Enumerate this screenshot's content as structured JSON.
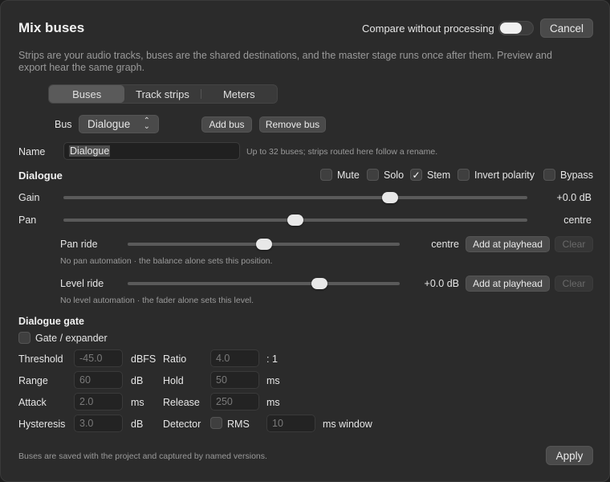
{
  "header": {
    "title": "Mix buses",
    "compare_label": "Compare without processing",
    "compare_on": false,
    "cancel_label": "Cancel"
  },
  "description": "Strips are your audio tracks, buses are the shared destinations, and the master stage runs once after them. Preview and export hear the same graph.",
  "tabs": [
    {
      "label": "Buses",
      "selected": true
    },
    {
      "label": "Track strips",
      "selected": false
    },
    {
      "label": "Meters",
      "selected": false
    }
  ],
  "bus": {
    "label": "Bus",
    "selected": "Dialogue",
    "add_label": "Add bus",
    "remove_label": "Remove bus"
  },
  "name": {
    "label": "Name",
    "value": "Dialogue",
    "hint": "Up to 32 buses; strips routed here follow a rename."
  },
  "strip": {
    "heading": "Dialogue",
    "options": [
      {
        "label": "Mute",
        "checked": false
      },
      {
        "label": "Solo",
        "checked": false
      },
      {
        "label": "Stem",
        "checked": true
      },
      {
        "label": "Invert polarity",
        "checked": false
      },
      {
        "label": "Bypass",
        "checked": false
      }
    ],
    "gain": {
      "label": "Gain",
      "value": "+0.0 dB",
      "level": 0.705
    },
    "pan": {
      "label": "Pan",
      "value": "centre",
      "level": 0.5
    }
  },
  "automation": {
    "pan_ride": {
      "label": "Pan ride",
      "value": "centre",
      "level": 0.5,
      "add_label": "Add at playhead",
      "clear_label": "Clear",
      "note": "No pan automation · the balance alone sets this position."
    },
    "level_ride": {
      "label": "Level ride",
      "value": "+0.0 dB",
      "level": 0.705,
      "add_label": "Add at playhead",
      "clear_label": "Clear",
      "note": "No level automation · the fader alone sets this level."
    }
  },
  "gate": {
    "heading": "Dialogue gate",
    "enable_label": "Gate / expander",
    "enabled": false,
    "threshold": {
      "label": "Threshold",
      "value": "-45.0",
      "unit": "dBFS"
    },
    "ratio": {
      "label": "Ratio",
      "value": "4.0",
      "unit": ": 1"
    },
    "range": {
      "label": "Range",
      "value": "60",
      "unit": "dB"
    },
    "hold": {
      "label": "Hold",
      "value": "50",
      "unit": "ms"
    },
    "attack": {
      "label": "Attack",
      "value": "2.0",
      "unit": "ms"
    },
    "release": {
      "label": "Release",
      "value": "250",
      "unit": "ms"
    },
    "hysteresis": {
      "label": "Hysteresis",
      "value": "3.0",
      "unit": "dB"
    },
    "detector": {
      "label": "Detector",
      "rms_label": "RMS",
      "rms_checked": false,
      "window_value": "10",
      "window_unit": "ms window"
    }
  },
  "footer": {
    "note": "Buses are saved with the project and captured by named versions.",
    "apply_label": "Apply"
  }
}
